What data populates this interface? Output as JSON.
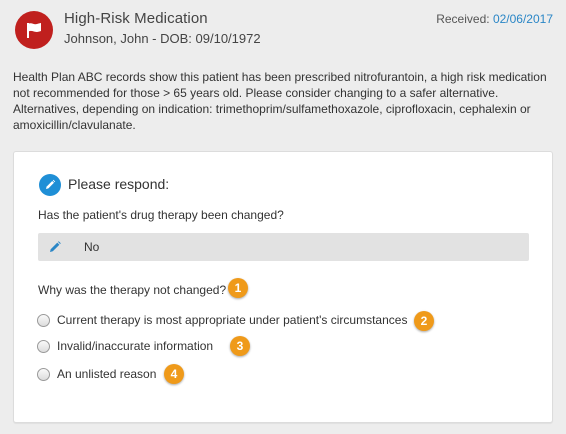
{
  "header": {
    "icon": "flag-icon",
    "title": "High-Risk Medication",
    "patient": "Johnson, John - DOB: 09/10/1972",
    "received_label": "Received:",
    "received_date": "02/06/2017"
  },
  "message": "Health Plan ABC records show this patient has been prescribed nitrofurantoin, a high risk medication not recommended for those > 65 years old. Please consider changing to a safer alternative. Alternatives, depending on indication: trimethoprim/sulfamethoxazole, ciprofloxacin, cephalexin or amoxicillin/clavulanate.",
  "form": {
    "respond_icon": "pencil-icon",
    "respond_label": "Please respond:",
    "question1": "Has the patient's drug therapy been changed?",
    "answer1": "No",
    "question2": "Why was the therapy not changed?",
    "options": [
      "Current therapy is most appropriate under patient's circumstances",
      "Invalid/inaccurate information",
      "An unlisted reason"
    ],
    "markers": [
      "1",
      "2",
      "3",
      "4"
    ]
  },
  "colors": {
    "flag_badge": "#c0201e",
    "accent_blue": "#2a86c6",
    "marker_orange": "#ef9a1a",
    "answer_bar": "#e2e2e2"
  }
}
